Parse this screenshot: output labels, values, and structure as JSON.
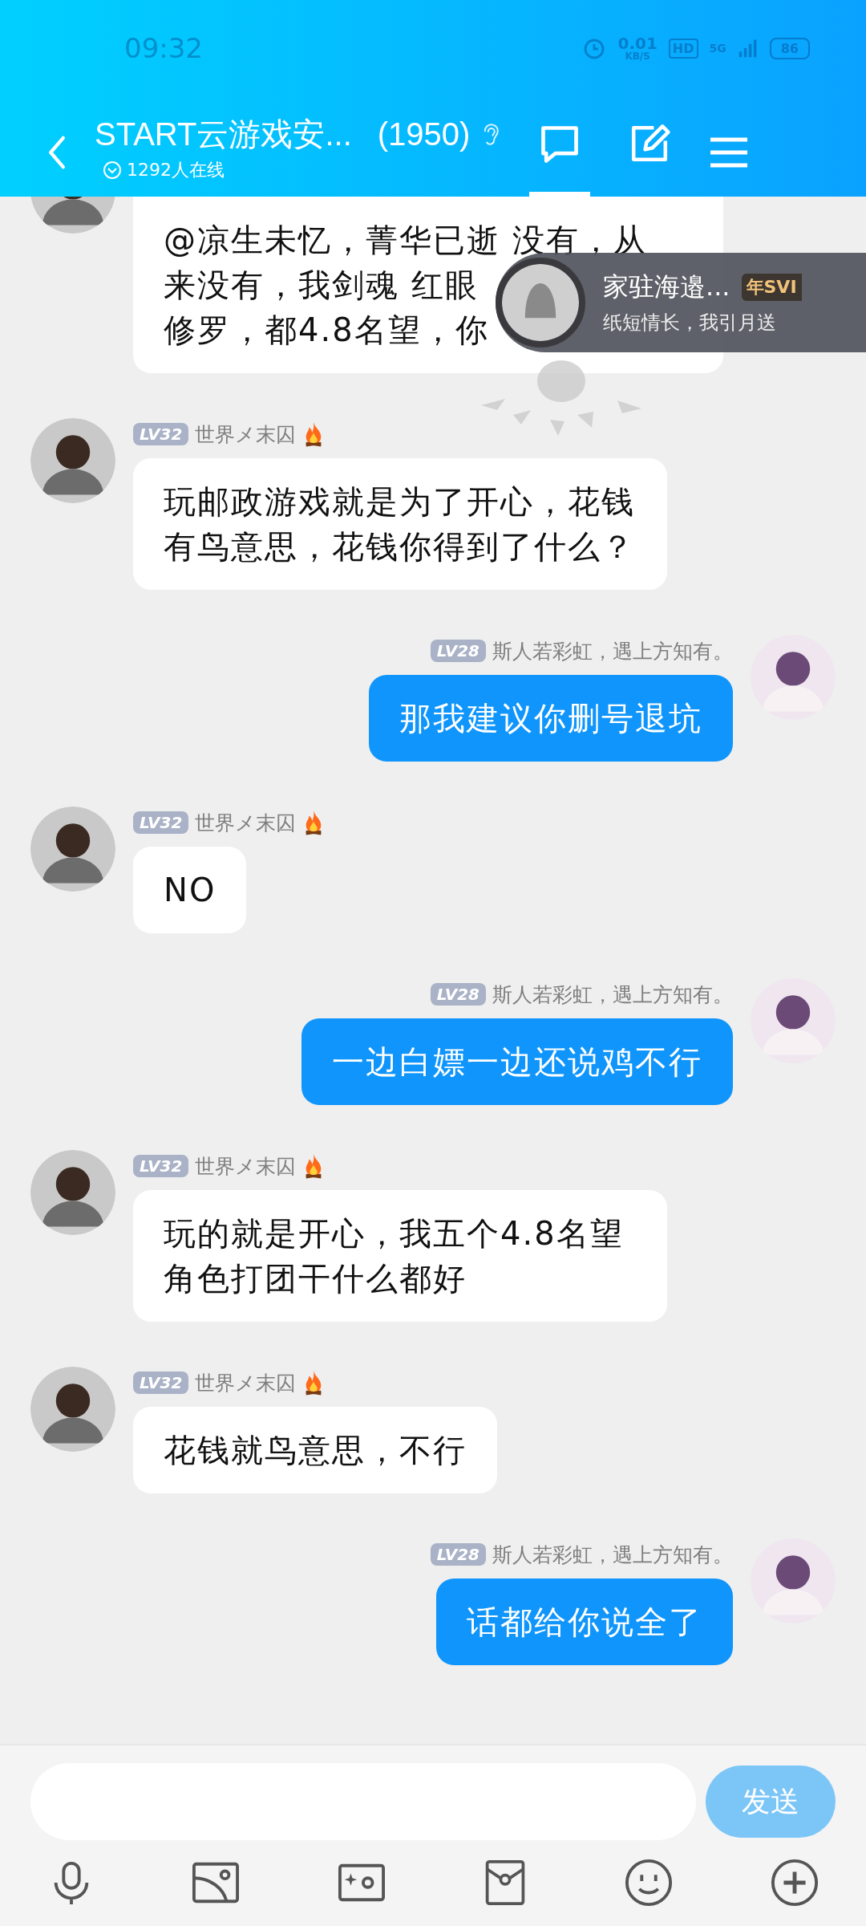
{
  "status_bar": {
    "time": "09:32",
    "speed": "0.01",
    "speed_unit": "KB/S",
    "hd": "HD",
    "network": "5G",
    "battery": "86"
  },
  "header": {
    "title": "START云游戏安...",
    "member_count": "(1950)",
    "online": "1292人在线",
    "tabs": [
      {
        "kind": "chat",
        "selected": true
      },
      {
        "kind": "edit",
        "selected": false
      }
    ]
  },
  "messages": [
    {
      "kind": "incoming",
      "lines": [
        "@凉生未忆，菁华已逝 没有，从",
        "来没有，我剑魂 红眼",
        "修罗，都4.8名望，你"
      ]
    },
    {
      "kind": "incoming",
      "level": "LV32",
      "name": "世界メ末囚",
      "flame": true,
      "text": "玩邮政游戏就是为了开心，花钱有鸟意思，花钱你得到了什么？"
    },
    {
      "kind": "outgoing",
      "level": "LV28",
      "name": "斯人若彩虹，遇上方知有。",
      "flame": false,
      "text": "那我建议你删号退坑"
    },
    {
      "kind": "incoming",
      "level": "LV32",
      "name": "世界メ末囚",
      "flame": true,
      "text": "NO"
    },
    {
      "kind": "outgoing",
      "level": "LV28",
      "name": "斯人若彩虹，遇上方知有。",
      "flame": false,
      "text": "一边白嫖一边还说鸡不行"
    },
    {
      "kind": "incoming",
      "level": "LV32",
      "name": "世界メ末囚",
      "flame": true,
      "text": "玩的就是开心，我五个4.8名望角色打团干什么都好"
    },
    {
      "kind": "incoming",
      "level": "LV32",
      "name": "世界メ末囚",
      "flame": true,
      "text": "花钱就鸟意思，不行"
    },
    {
      "kind": "outgoing",
      "level": "LV28",
      "name": "斯人若彩虹，遇上方知有。",
      "flame": false,
      "text": "话都给你说全了"
    }
  ],
  "popup": {
    "name": "家驻海邉...",
    "badge": "年SVI",
    "subtitle": "纸短情长，我引月送"
  },
  "composer": {
    "send": "发送"
  }
}
